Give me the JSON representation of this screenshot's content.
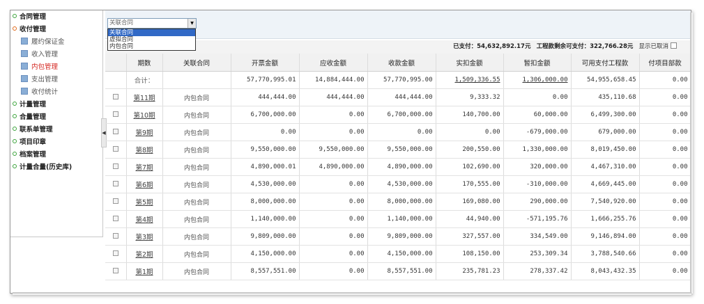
{
  "sidebar": {
    "items": [
      {
        "label": "合同管理",
        "open": false
      },
      {
        "label": "收付管理",
        "open": true
      },
      {
        "label": "计量管理",
        "open": false
      },
      {
        "label": "合量管理",
        "open": false
      },
      {
        "label": "联系单管理",
        "open": false
      },
      {
        "label": "项目印章",
        "open": false
      },
      {
        "label": "档案管理",
        "open": false
      },
      {
        "label": "计量合量(历史库)",
        "open": false
      }
    ],
    "subitems": [
      "履约保证金",
      "收入管理",
      "内包管理",
      "支出管理",
      "收付统计"
    ],
    "active_subitem": "内包管理"
  },
  "toolbar": {
    "select_value": "关联合同",
    "dropdown_options": [
      "关联合同",
      "虚拟合同",
      "内包合同"
    ],
    "selected_option": "关联合同"
  },
  "summary": {
    "paid_label": "已支付：",
    "paid_value": "54,632,892.17元",
    "remaining_label": "工程款剩余可支付：",
    "remaining_value": "322,766.28元",
    "show_cancelled_label": "显示已取消"
  },
  "table": {
    "columns": [
      "",
      "期数",
      "关联合同",
      "开票金额",
      "应收金额",
      "收款金额",
      "实扣金额",
      "暂扣金额",
      "可用支付工程款",
      "付项目部款"
    ],
    "total": {
      "label": "合计：",
      "invoice": "57,770,995.01",
      "receivable": "14,884,444.00",
      "received": "57,770,995.00",
      "deducted": "1,509,336.55",
      "withheld": "1,306,000.00",
      "available": "54,955,658.45",
      "paid_dept": "0.00"
    },
    "rows": [
      {
        "period": "第11期",
        "contract": "内包合同",
        "invoice": "444,444.00",
        "receivable": "444,444.00",
        "received": "444,444.00",
        "deducted": "9,333.32",
        "withheld": "0.00",
        "available": "435,110.68",
        "paid_dept": "0.00"
      },
      {
        "period": "第10期",
        "contract": "内包合同",
        "invoice": "6,700,000.00",
        "receivable": "0.00",
        "received": "6,700,000.00",
        "deducted": "140,700.00",
        "withheld": "60,000.00",
        "available": "6,499,300.00",
        "paid_dept": "0.00"
      },
      {
        "period": "第9期",
        "contract": "内包合同",
        "invoice": "0.00",
        "receivable": "0.00",
        "received": "0.00",
        "deducted": "0.00",
        "withheld": "-679,000.00",
        "available": "679,000.00",
        "paid_dept": "0.00"
      },
      {
        "period": "第8期",
        "contract": "内包合同",
        "invoice": "9,550,000.00",
        "receivable": "9,550,000.00",
        "received": "9,550,000.00",
        "deducted": "200,550.00",
        "withheld": "1,330,000.00",
        "available": "8,019,450.00",
        "paid_dept": "0.00"
      },
      {
        "period": "第7期",
        "contract": "内包合同",
        "invoice": "4,890,000.01",
        "receivable": "4,890,000.00",
        "received": "4,890,000.00",
        "deducted": "102,690.00",
        "withheld": "320,000.00",
        "available": "4,467,310.00",
        "paid_dept": "0.00"
      },
      {
        "period": "第6期",
        "contract": "内包合同",
        "invoice": "4,530,000.00",
        "receivable": "0.00",
        "received": "4,530,000.00",
        "deducted": "170,555.00",
        "withheld": "-310,000.00",
        "available": "4,669,445.00",
        "paid_dept": "0.00"
      },
      {
        "period": "第5期",
        "contract": "内包合同",
        "invoice": "8,000,000.00",
        "receivable": "0.00",
        "received": "8,000,000.00",
        "deducted": "169,080.00",
        "withheld": "290,000.00",
        "available": "7,540,920.00",
        "paid_dept": "0.00"
      },
      {
        "period": "第4期",
        "contract": "内包合同",
        "invoice": "1,140,000.00",
        "receivable": "0.00",
        "received": "1,140,000.00",
        "deducted": "44,940.00",
        "withheld": "-571,195.76",
        "available": "1,666,255.76",
        "paid_dept": "0.00"
      },
      {
        "period": "第3期",
        "contract": "内包合同",
        "invoice": "9,809,000.00",
        "receivable": "0.00",
        "received": "9,809,000.00",
        "deducted": "327,557.00",
        "withheld": "334,549.00",
        "available": "9,146,894.00",
        "paid_dept": "0.00"
      },
      {
        "period": "第2期",
        "contract": "内包合同",
        "invoice": "4,150,000.00",
        "receivable": "0.00",
        "received": "4,150,000.00",
        "deducted": "108,150.00",
        "withheld": "253,309.34",
        "available": "3,788,540.66",
        "paid_dept": "0.00"
      },
      {
        "period": "第1期",
        "contract": "内包合同",
        "invoice": "8,557,551.00",
        "receivable": "0.00",
        "received": "8,557,551.00",
        "deducted": "235,781.23",
        "withheld": "278,337.42",
        "available": "8,043,432.35",
        "paid_dept": "0.00"
      }
    ]
  }
}
